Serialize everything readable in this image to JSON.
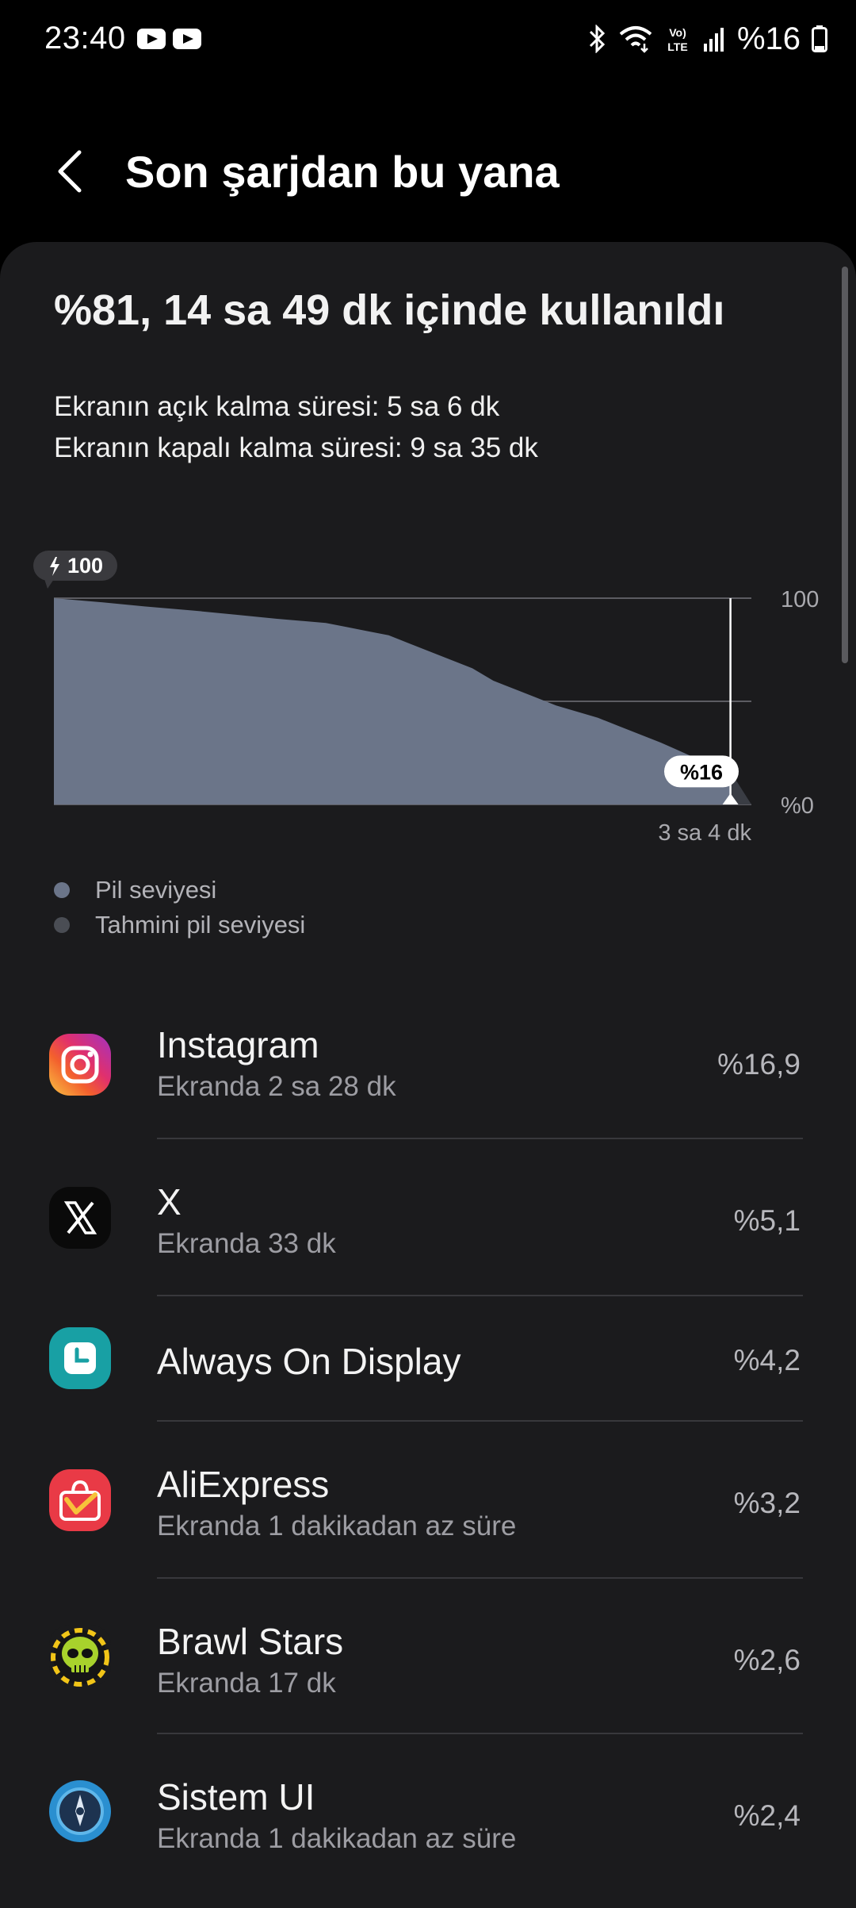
{
  "status_bar": {
    "time": "23:40",
    "battery_text": "%16",
    "icons": [
      "youtube-icon",
      "youtube-icon",
      "bluetooth-icon",
      "wifi-icon",
      "volte-icon",
      "signal-icon",
      "battery-icon"
    ]
  },
  "header": {
    "title": "Son şarjdan bu yana",
    "back_icon": "chevron-left-icon"
  },
  "summary": {
    "title": "%81, 14 sa 49 dk içinde kullanıldı",
    "screen_on": "Ekranın açık kalma süresi: 5 sa 6 dk",
    "screen_off": "Ekranın kapalı kalma süresi: 9 sa 35 dk"
  },
  "chart_data": {
    "type": "area",
    "title": "",
    "xlabel": "",
    "ylabel": "",
    "ylim": [
      0,
      100
    ],
    "y_ticks": [
      "100",
      "%0"
    ],
    "start_badge": "100",
    "current_badge": "%16",
    "x_label_right": "3 sa 4 dk",
    "grid": true,
    "series": [
      {
        "name": "Pil seviyesi",
        "color": "#6b7589",
        "points": [
          [
            0,
            100
          ],
          [
            0.07,
            98
          ],
          [
            0.13,
            96
          ],
          [
            0.2,
            94
          ],
          [
            0.26,
            92
          ],
          [
            0.32,
            90
          ],
          [
            0.39,
            88
          ],
          [
            0.42,
            86
          ],
          [
            0.45,
            84
          ],
          [
            0.48,
            82
          ],
          [
            0.51,
            78
          ],
          [
            0.54,
            74
          ],
          [
            0.57,
            70
          ],
          [
            0.6,
            66
          ],
          [
            0.63,
            60
          ],
          [
            0.66,
            56
          ],
          [
            0.69,
            52
          ],
          [
            0.72,
            48
          ],
          [
            0.75,
            45
          ],
          [
            0.78,
            42
          ],
          [
            0.81,
            38
          ],
          [
            0.84,
            34
          ],
          [
            0.87,
            30
          ],
          [
            0.89,
            27
          ],
          [
            0.91,
            24
          ],
          [
            0.93,
            21
          ],
          [
            0.95,
            18
          ],
          [
            0.97,
            16
          ]
        ]
      },
      {
        "name": "Tahmini pil seviyesi",
        "color": "#3a3d44",
        "points": [
          [
            0.97,
            16
          ],
          [
            1.0,
            0
          ]
        ]
      }
    ]
  },
  "legend": [
    {
      "label": "Pil seviyesi",
      "color": "#6b7589"
    },
    {
      "label": "Tahmini pil seviyesi",
      "color": "#4a4d54"
    }
  ],
  "apps": [
    {
      "name": "Instagram",
      "sub": "Ekranda 2 sa 28 dk",
      "pct": "%16,9",
      "icon": "instagram-icon"
    },
    {
      "name": "X",
      "sub": "Ekranda 33 dk",
      "pct": "%5,1",
      "icon": "x-icon"
    },
    {
      "name": "Always On Display",
      "sub": "",
      "pct": "%4,2",
      "icon": "clock-icon"
    },
    {
      "name": "AliExpress",
      "sub": "Ekranda 1 dakikadan az süre",
      "pct": "%3,2",
      "icon": "shopping-bag-icon"
    },
    {
      "name": "Brawl Stars",
      "sub": "Ekranda 17 dk",
      "pct": "%2,6",
      "icon": "skull-icon"
    },
    {
      "name": "Sistem UI",
      "sub": "Ekranda 1 dakikadan az süre",
      "pct": "%2,4",
      "icon": "gear-icon"
    }
  ]
}
